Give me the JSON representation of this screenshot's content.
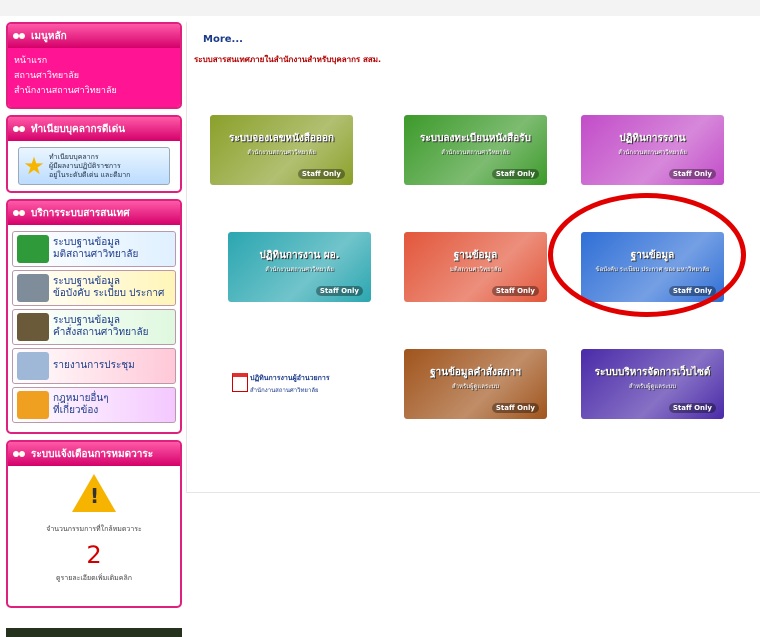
{
  "sidebar": {
    "main_menu": {
      "title": "เมนูหลัก",
      "items": [
        "หน้าแรก",
        "สถานศาวิทยาลัย",
        "สำนักงานสถานศาวิทยาลัย"
      ]
    },
    "staff_panel": {
      "title": "ทำเนียบบุคลากรดีเด่น",
      "button_lines": [
        "ทำเนียบบุคลากร",
        "ผู้มีผลงานปฏิบัติราชการ",
        "อยู่ในระดับดีเด่น และดีมาก"
      ]
    },
    "services_panel": {
      "title": "บริการระบบสารสนเทศ",
      "items": [
        {
          "line1": "ระบบฐานข้อมูล",
          "line2": "มติสถานศาวิทยาลัย"
        },
        {
          "line1": "ระบบฐานข้อมูล",
          "line2": "ข้อบังคับ ระเบียบ ประกาศ"
        },
        {
          "line1": "ระบบฐานข้อมูล",
          "line2": "คำสั่งสถานศาวิทยาลัย"
        },
        {
          "line1": "รายงานการประชุม",
          "line2": ""
        },
        {
          "line1": "กฎหมายอื่นๆ",
          "line2": "ที่เกี่ยวข้อง"
        }
      ]
    },
    "alert_panel": {
      "title": "ระบบแจ้งเตือนการหมดวาระ",
      "label": "จำนวนกรรมการที่ใกล้หมดวาระ",
      "count": "2",
      "more": "ดูรายละเอียดเพิ่มเติมคลิก"
    }
  },
  "main": {
    "more_link": "More...",
    "subtitle": "ระบบสารสนเทศภายในสำนักงานสำหรับบุคลากร สสม.",
    "tiles": [
      {
        "line1": "ระบบจองเลขหนังสือออก",
        "line2": "สำนักงานสถานศาวิทยาลัย",
        "badge": "Staff Only",
        "color": "#8aa02a"
      },
      {
        "line1": "ระบบลงทะเบียนหนังสือรับ",
        "line2": "สำนักงานสถานศาวิทยาลัย",
        "badge": "Staff Only",
        "color": "#3c9a2a"
      },
      {
        "line1": "ปฏิทินการรงาน",
        "line2": "สำนักงานสถานศาวิทยาลัย",
        "badge": "Staff Only",
        "color": "#c24cc8"
      },
      {
        "line1": "ปฏิทินการงาน ผอ.",
        "line2": "สำนักงานสถานศาวิทยาลัย",
        "badge": "Staff Only",
        "color": "#2aa6b0"
      },
      {
        "line1": "ฐานข้อมูล",
        "line2": "มติสถานศาวิทยาลัย",
        "badge": "Staff Only",
        "color": "#e2563a"
      },
      {
        "line1": "ฐานข้อมูล",
        "line2": "ข้อบังคับ ระเบียบ ประกาศ ของ มหาวิทยาลัย",
        "badge": "Staff Only",
        "color": "#2f6fd6"
      },
      {
        "line1": "ปฏิทินการงานผู้อำนวยการ",
        "line2": "สำนักงานสถานศาวิทยาลัย",
        "badge": "",
        "color": "#ffffff"
      },
      {
        "line1": "ฐานข้อมูลคำสั่งสภาฯ",
        "line2": "สำหรับผู้ดูแลระบบ",
        "badge": "Staff Only",
        "color": "#a0541c"
      },
      {
        "line1": "ระบบบริหารจัดการเว็บไซต์",
        "line2": "สำหรับผู้ดูแลระบบ",
        "badge": "Staff Only",
        "color": "#4a2aa8"
      }
    ]
  }
}
